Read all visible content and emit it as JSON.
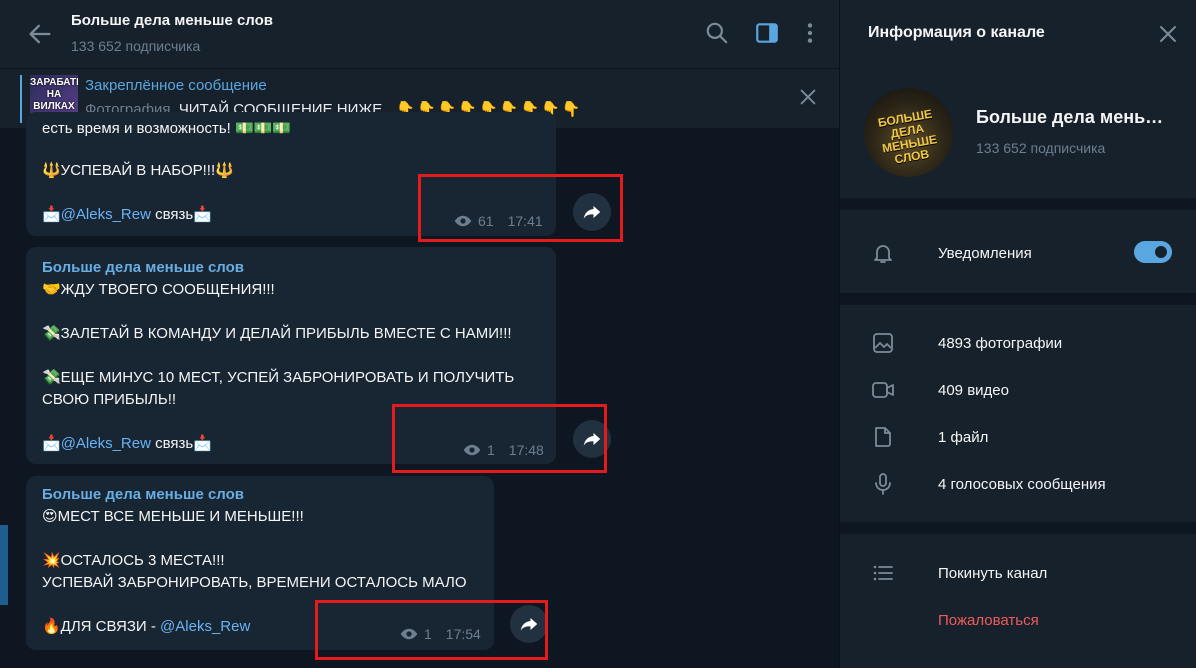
{
  "header": {
    "title": "Больше дела меньше слов",
    "subtitle": "133 652 подписчика",
    "icons": [
      "back-arrow-icon",
      "search-icon",
      "sidebar-toggle-icon",
      "more-vertical-icon"
    ]
  },
  "pinned": {
    "title": "Закреплённое сообщение",
    "thumb_text": "ЗАРАБАТЬ НА ВИЛКАХ",
    "prefix": "Фотография,",
    "text": "ЧИТАЙ СООБЩЕНИЕ НИЖЕ",
    "emojis": "👇👇👇👇👇👇👇👇👇"
  },
  "messages": [
    {
      "top_line": "есть время и возможность! 💵💵💵",
      "line1": "🔱УСПЕВАЙ В НАБОР!!!🔱",
      "contact_prefix": "📩",
      "contact_link": "@Aleks_Rew",
      "contact_suffix": " связь📩",
      "views": "61",
      "time": "17:41"
    },
    {
      "sender": "Больше дела меньше слов",
      "line1": "🤝ЖДУ ТВОЕГО СООБЩЕНИЯ!!!",
      "line2": "💸ЗАЛЕТАЙ В КОМАНДУ И ДЕЛАЙ ПРИБЫЛЬ ВМЕСТЕ С НАМИ!!!",
      "line3": "💸ЕЩЕ МИНУС 10 МЕСТ, УСПЕЙ ЗАБРОНИРОВАТЬ И ПОЛУЧИТЬ",
      "line4": "СВОЮ ПРИБЫЛЬ!!",
      "contact_prefix": "📩",
      "contact_link": "@Aleks_Rew",
      "contact_suffix": " связь📩",
      "views": "1",
      "time": "17:48"
    },
    {
      "sender": "Больше дела меньше слов",
      "line1": "😍МЕСТ ВСЕ МЕНЬШЕ И МЕНЬШЕ!!!",
      "line2": "💥ОСТАЛОСЬ 3 МЕСТА!!!",
      "line3": "УСПЕВАЙ ЗАБРОНИРОВАТЬ, ВРЕМЕНИ ОСТАЛОСЬ МАЛО",
      "contact_prefix": "🔥ДЛЯ СВЯЗИ - ",
      "contact_link": "@Aleks_Rew",
      "views": "1",
      "time": "17:54"
    }
  ],
  "info": {
    "title": "Информация о канале",
    "avatar_text": "БОЛЬШЕ ДЕЛА МЕНЬШЕ СЛОВ",
    "channel_name": "Больше дела меньше слов",
    "channel_sub": "133 652 подписчика",
    "notifications": {
      "label": "Уведомления",
      "enabled": true
    },
    "media": [
      {
        "icon": "photo-icon",
        "label": "4893 фотографии"
      },
      {
        "icon": "video-icon",
        "label": "409 видео"
      },
      {
        "icon": "file-icon",
        "label": "1 файл"
      },
      {
        "icon": "microphone-icon",
        "label": "4 голосовых сообщения"
      }
    ],
    "leave": "Покинуть канал",
    "report": "Пожаловаться"
  },
  "colors": {
    "accent": "#5aa6e0",
    "danger": "#ef5b5b",
    "annotation": "#e31b1b",
    "bubble": "#182533",
    "panel": "#17212b",
    "background": "#0e1621"
  }
}
